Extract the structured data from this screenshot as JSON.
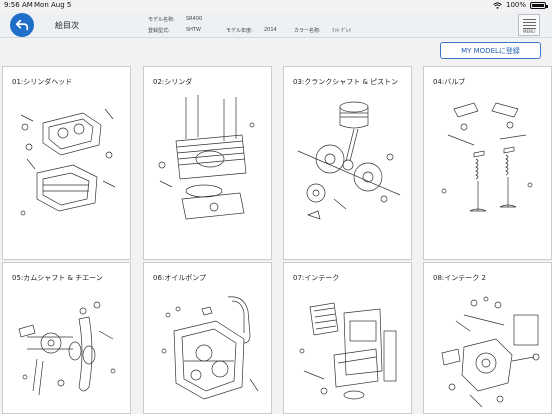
{
  "status": {
    "time": "9:56 AM",
    "date": "Mon Aug 5",
    "battery": "100%"
  },
  "header": {
    "title": "絵目次",
    "model_name_label": "モデル名称:",
    "model_name": "SR400",
    "reg_type_label": "登録型式:",
    "reg_type": "SHTW",
    "model_year_label": "モデル年度:",
    "model_year": "2014",
    "color_label": "カラー名称:",
    "color": "ﾏｯﾄ ｸﾞﾚｲ",
    "menu_label": "MENU"
  },
  "register_button": "MY MODELに登録",
  "cards": [
    {
      "title": "01:シリンダヘッド"
    },
    {
      "title": "02:シリンダ"
    },
    {
      "title": "03:クランクシャフト & ピストン"
    },
    {
      "title": "04:バルブ"
    },
    {
      "title": "05:カムシャフト & チエーン"
    },
    {
      "title": "06:オイルポンプ"
    },
    {
      "title": "07:インテーク"
    },
    {
      "title": "08:インテーク 2"
    }
  ]
}
